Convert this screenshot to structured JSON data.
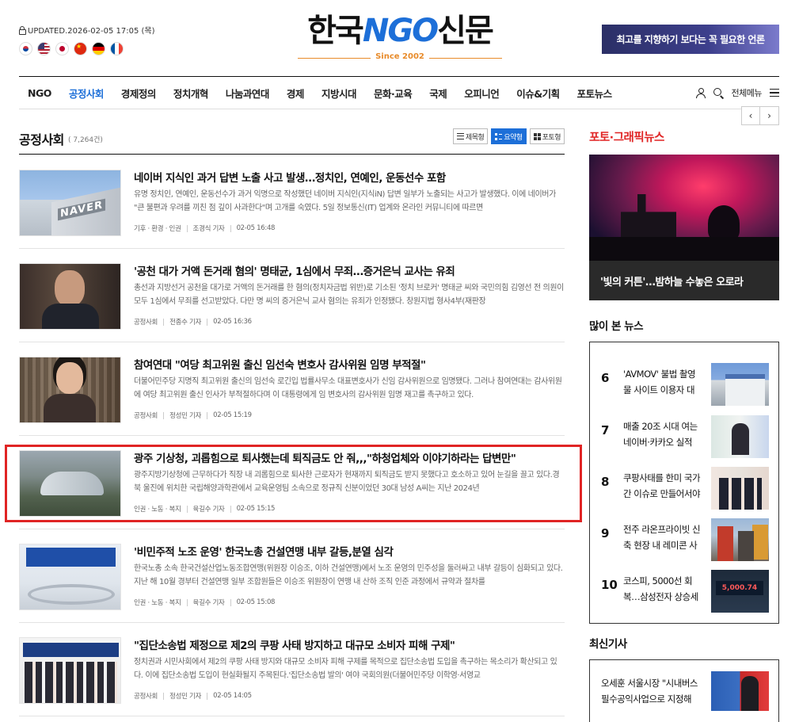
{
  "header": {
    "updated": "UPDATED.2026-02-05 17:05 (목)",
    "flags": [
      "korea-flag-icon",
      "usa-flag-icon",
      "japan-flag-icon",
      "china-flag-icon",
      "germany-flag-icon",
      "france-flag-icon"
    ],
    "logo_kr_1": "한국",
    "logo_ngo": "NGO",
    "logo_kr_2": "신문",
    "logo_since": "Since 2002",
    "banner_text": "최고를 지향하기 보다는 꼭 필요한 언론"
  },
  "nav": {
    "items": [
      "NGO",
      "공정사회",
      "경제정의",
      "정치개혁",
      "나눔과연대",
      "경제",
      "지방시대",
      "문화·교육",
      "국제",
      "오피니언",
      "이슈&기획",
      "포토뉴스"
    ],
    "active": "공정사회",
    "menu_label": "전체메뉴"
  },
  "section": {
    "title": "공정사회",
    "count": "( 7,264건)",
    "views": [
      "제목형",
      "요약형",
      "포토형"
    ],
    "active_view": "요약형"
  },
  "articles": [
    {
      "title": "네이버 지식인 과거 답변 노출 사고 발생…정치인, 연예인, 운동선수 포함",
      "summary": "유명 정치인, 연예인, 운동선수가 과거 익명으로 작성했던 네이버 지식인(지식iN) 답변 일부가 노출되는 사고가 발생했다. 이에 네이버가 \"큰 불편과 우려를 끼친 점 깊이 사과한다\"며 고개를 숙였다. 5일 정보통신(IT) 업계와 온라인 커뮤니티에 따르면",
      "category": "기후 · 환경 · 인권",
      "author": "조경식 기자",
      "date": "02-05 16:48",
      "thumb_sign": "NAVER"
    },
    {
      "title": "'공천 대가 거액 돈거래 혐의' 명태균, 1심에서 무죄…증거은닉 교사는 유죄",
      "summary": "총선과 지방선거 공천을 대가로 거액의 돈거래를 한 혐의(정치자금법 위반)로 기소된 '정치 브로커' 명태균 씨와 국민의힘 김영선 전 의원이 모두 1심에서 무죄를 선고받았다. 다만 명 씨의 증거은닉 교사 혐의는 유죄가 인정됐다. 창원지법 형사4부(재판장",
      "category": "공정사회",
      "author": "전종수 기자",
      "date": "02-05 16:36"
    },
    {
      "title": "참여연대 \"여당 최고위원 출신 임선숙 변호사 감사위원 임명 부적절\"",
      "summary": "더불어민주당 지명직 최고위원 출신의 임선숙 로긴입 법률사무소 대표변호사가 신임 감사위원으로 임명됐다. 그러나 참여연대는 감사위원에 여당 최고위원 출신 인사가 부적절하다며 이 대통령에게 임 변호사의 감사위원 임명 재고를 촉구하고 있다.",
      "category": "공정사회",
      "author": "정성민 기자",
      "date": "02-05 15:19"
    },
    {
      "title": "광주 기상청, 괴롭힘으로 퇴사했는데 퇴직금도 안 줘,,,\"하청업체와 이야기하라는 답변만\"",
      "summary": "광주지방기상청에 근무하다가 직장 내 괴롭힘으로 퇴사한 근로자가 현재까지 퇴직금도 받지 못했다고 호소하고 있어 눈길을 끌고 있다.경북 울진에 위치한 국립해양과학관에서 교육운영팀 소속으로 정규직 신분이었던 30대 남성 A씨는 지난 2024년",
      "category": "인권 · 노동 · 복지",
      "author": "육길수 기자",
      "date": "02-05 15:15"
    },
    {
      "title": "'비민주적 노조 운영' 한국노총 건설연맹 내부 갈등,분열 심각",
      "summary": "한국노총 소속 한국건설산업노동조합연맹(위원장 이승조, 이하 건설연맹)에서 노조 운영의 민주성을 둘러싸고 내부 갈등이 심화되고 있다.지난 해 10월 경부터 건설연맹 일부 조합원들은 이승조 위원장이 연맹 내 산하 조직 인준 과정에서 규약과 절차를",
      "category": "인권 · 노동 · 복지",
      "author": "육길수 기자",
      "date": "02-05 15:08"
    },
    {
      "title": "\"집단소송법 제정으로 제2의 쿠팡 사태 방지하고 대규모 소비자 피해 구제\"",
      "summary": "정치권과 시민사회에서 제2의 쿠팡 사태 방지와 대규모 소비자 피해 구제를 목적으로 집단소송법 도입을 촉구하는 목소리가 확산되고 있다. 이에 집단소송법 도입이 현실화될지 주목된다.'집단소송법 발의' 여야 국회의원(더불어민주당 이학영·서영교",
      "category": "공정사회",
      "author": "정성민 기자",
      "date": "02-05 14:05"
    }
  ],
  "sidebar": {
    "photo_title": "포토·그래픽뉴스",
    "photo_caption": "'빛의 커튼'…밤하늘 수놓은 오로라",
    "popular_title": "많이 본 뉴스",
    "popular": [
      {
        "num": "6",
        "text": "'AVMOV' 불법 촬영물 사이트 이용자 대거 적발"
      },
      {
        "num": "7",
        "text": "매출 20조 시대 여는 네이버·카카오 실적 발표"
      },
      {
        "num": "8",
        "text": "쿠팡사태를 한미 국가간 이슈로 만들어서야"
      },
      {
        "num": "9",
        "text": "전주 라온프라이빗 신축 현장 내 레미콘 사고"
      },
      {
        "num": "10",
        "text": "코스피, 5000선 회복…삼성전자 상승세"
      }
    ],
    "latest_title": "최신기사",
    "latest_text": "오세훈 서울시장 \"시내버스 필수공익사업으로 지정해야\""
  }
}
